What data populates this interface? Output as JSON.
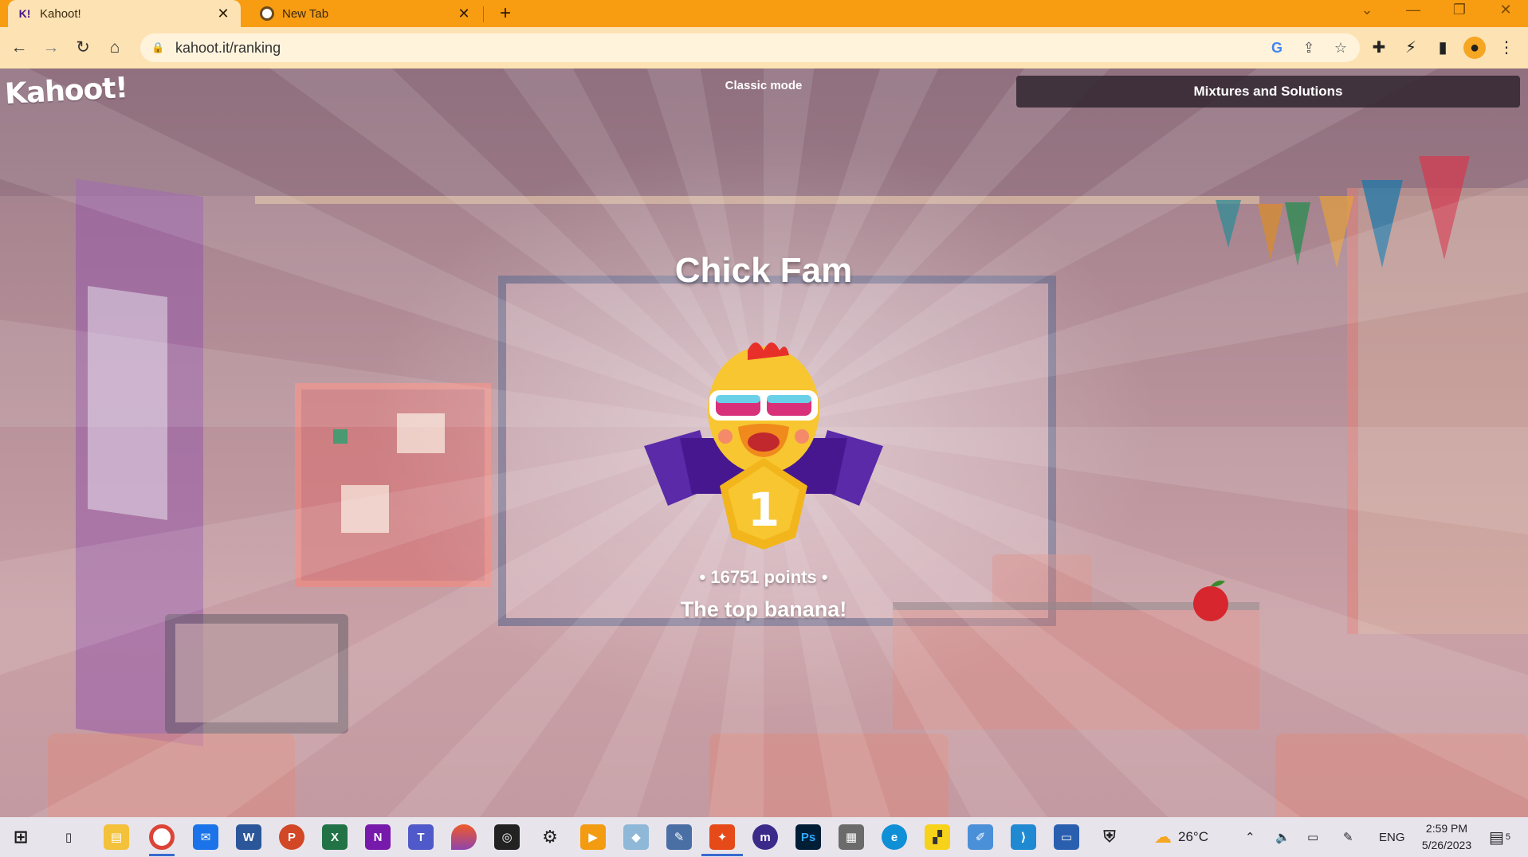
{
  "browser": {
    "tabs": [
      {
        "title": "Kahoot!",
        "favicon": "kahoot-icon",
        "active": true
      },
      {
        "title": "New Tab",
        "favicon": "chrome-icon",
        "active": false
      }
    ],
    "new_tab": "+",
    "url": "kahoot.it/ranking",
    "accent_color": "#f89c12"
  },
  "kahoot": {
    "logo": "Kahoot!",
    "mode": "Classic mode",
    "quiz_title": "Mixtures and Solutions",
    "player_name": "Chick Fam",
    "rank": "1",
    "points": "• 16751 points •",
    "tagline": "The top banana!"
  },
  "taskbar": {
    "apps": [
      "windows-start",
      "task-view",
      "file-explorer",
      "chrome",
      "mail",
      "word",
      "powerpoint",
      "excel",
      "onenote",
      "teams",
      "paint-drop",
      "snipping",
      "settings",
      "media",
      "notes",
      "sketch",
      "active-app",
      "mu",
      "photoshop",
      "calculator",
      "edge",
      "sticky-notes",
      "editor",
      "vscode",
      "remote",
      "security"
    ],
    "weather": "26°C",
    "language": "ENG",
    "time": "2:59 PM",
    "date": "5/26/2023",
    "notification_count": "5"
  }
}
